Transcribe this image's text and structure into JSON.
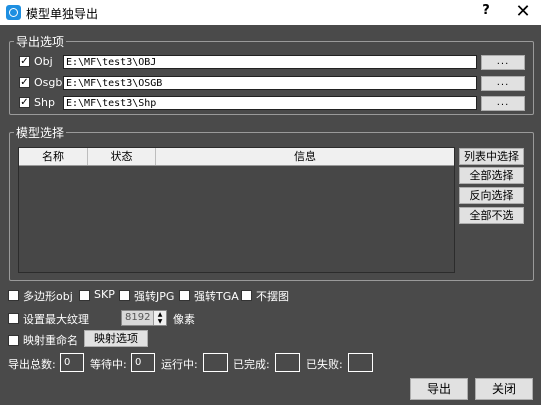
{
  "window": {
    "title": "模型单独导出",
    "help": "?",
    "close": "✕"
  },
  "export_options": {
    "legend": "导出选项",
    "rows": [
      {
        "label": "Obj",
        "checked": true,
        "path": "E:\\MF\\test3\\OBJ",
        "browse": "..."
      },
      {
        "label": "Osgb",
        "checked": true,
        "path": "E:\\MF\\test3\\OSGB",
        "browse": "..."
      },
      {
        "label": "Shp",
        "checked": true,
        "path": "E:\\MF\\test3\\Shp",
        "browse": "..."
      }
    ]
  },
  "model_select": {
    "legend": "模型选择",
    "columns": [
      "名称",
      "状态",
      "信息"
    ],
    "buttons": {
      "list_select": "列表中选择",
      "select_all": "全部选择",
      "invert": "反向选择",
      "select_none": "全部不选"
    }
  },
  "options": {
    "polygon_obj": {
      "label": "多边形obj",
      "checked": false
    },
    "skp": {
      "label": "SKP",
      "checked": false
    },
    "force_jpg": {
      "label": "强转JPG",
      "checked": false
    },
    "force_tga": {
      "label": "强转TGA",
      "checked": false
    },
    "no_texture": {
      "label": "不摆图",
      "checked": false
    },
    "max_texture": {
      "label": "设置最大纹理",
      "checked": false,
      "value": "8192",
      "unit": "像素"
    },
    "mapping_rename": {
      "label": "映射重命名",
      "checked": false,
      "button": "映射选项"
    }
  },
  "stats": {
    "total_label": "导出总数:",
    "total": "0",
    "waiting_label": "等待中:",
    "waiting": "0",
    "running_label": "运行中:",
    "running": "",
    "done_label": "已完成:",
    "done": "",
    "failed_label": "已失败:",
    "failed": ""
  },
  "footer": {
    "export": "导出",
    "close": "关闭"
  }
}
